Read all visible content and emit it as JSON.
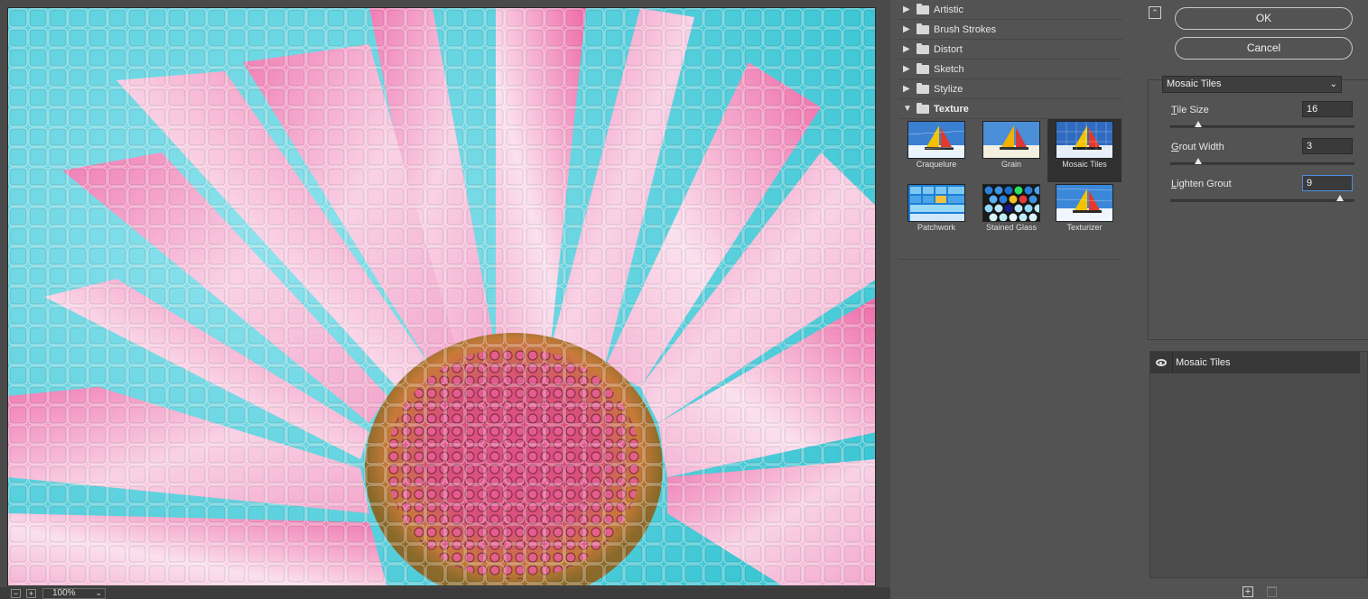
{
  "preview": {
    "zoom": "100%",
    "zoom_out_icon": "minus-square-icon",
    "zoom_in_icon": "plus-square-icon"
  },
  "gallery": {
    "categories": [
      {
        "label": "Artistic",
        "expanded": false
      },
      {
        "label": "Brush Strokes",
        "expanded": false
      },
      {
        "label": "Distort",
        "expanded": false
      },
      {
        "label": "Sketch",
        "expanded": false
      },
      {
        "label": "Stylize",
        "expanded": false
      },
      {
        "label": "Texture",
        "expanded": true
      }
    ],
    "texture_filters": [
      {
        "label": "Craquelure",
        "selected": false
      },
      {
        "label": "Grain",
        "selected": false
      },
      {
        "label": "Mosaic Tiles",
        "selected": true
      },
      {
        "label": "Patchwork",
        "selected": false
      },
      {
        "label": "Stained Glass",
        "selected": false
      },
      {
        "label": "Texturizer",
        "selected": false
      }
    ]
  },
  "panel": {
    "ok_label": "OK",
    "cancel_label": "Cancel",
    "filter_select": "Mosaic Tiles",
    "params": [
      {
        "label_first": "T",
        "label_rest": "ile Size",
        "value": "16",
        "slider_fraction": 0.15
      },
      {
        "label_first": "G",
        "label_rest": "rout Width",
        "value": "3",
        "slider_fraction": 0.15
      },
      {
        "label_first": "L",
        "label_rest": "ighten Grout",
        "value": "9",
        "slider_fraction": 0.92
      }
    ]
  },
  "layers": {
    "items": [
      {
        "name": "Mosaic Tiles",
        "visible": true
      }
    ],
    "new_icon": "new-layer-icon",
    "delete_icon": "trash-icon"
  },
  "colors": {
    "bg": "#535353",
    "preview_bg": "#4a4a4a",
    "selected": "#303030",
    "focus": "#4a8fe0"
  }
}
